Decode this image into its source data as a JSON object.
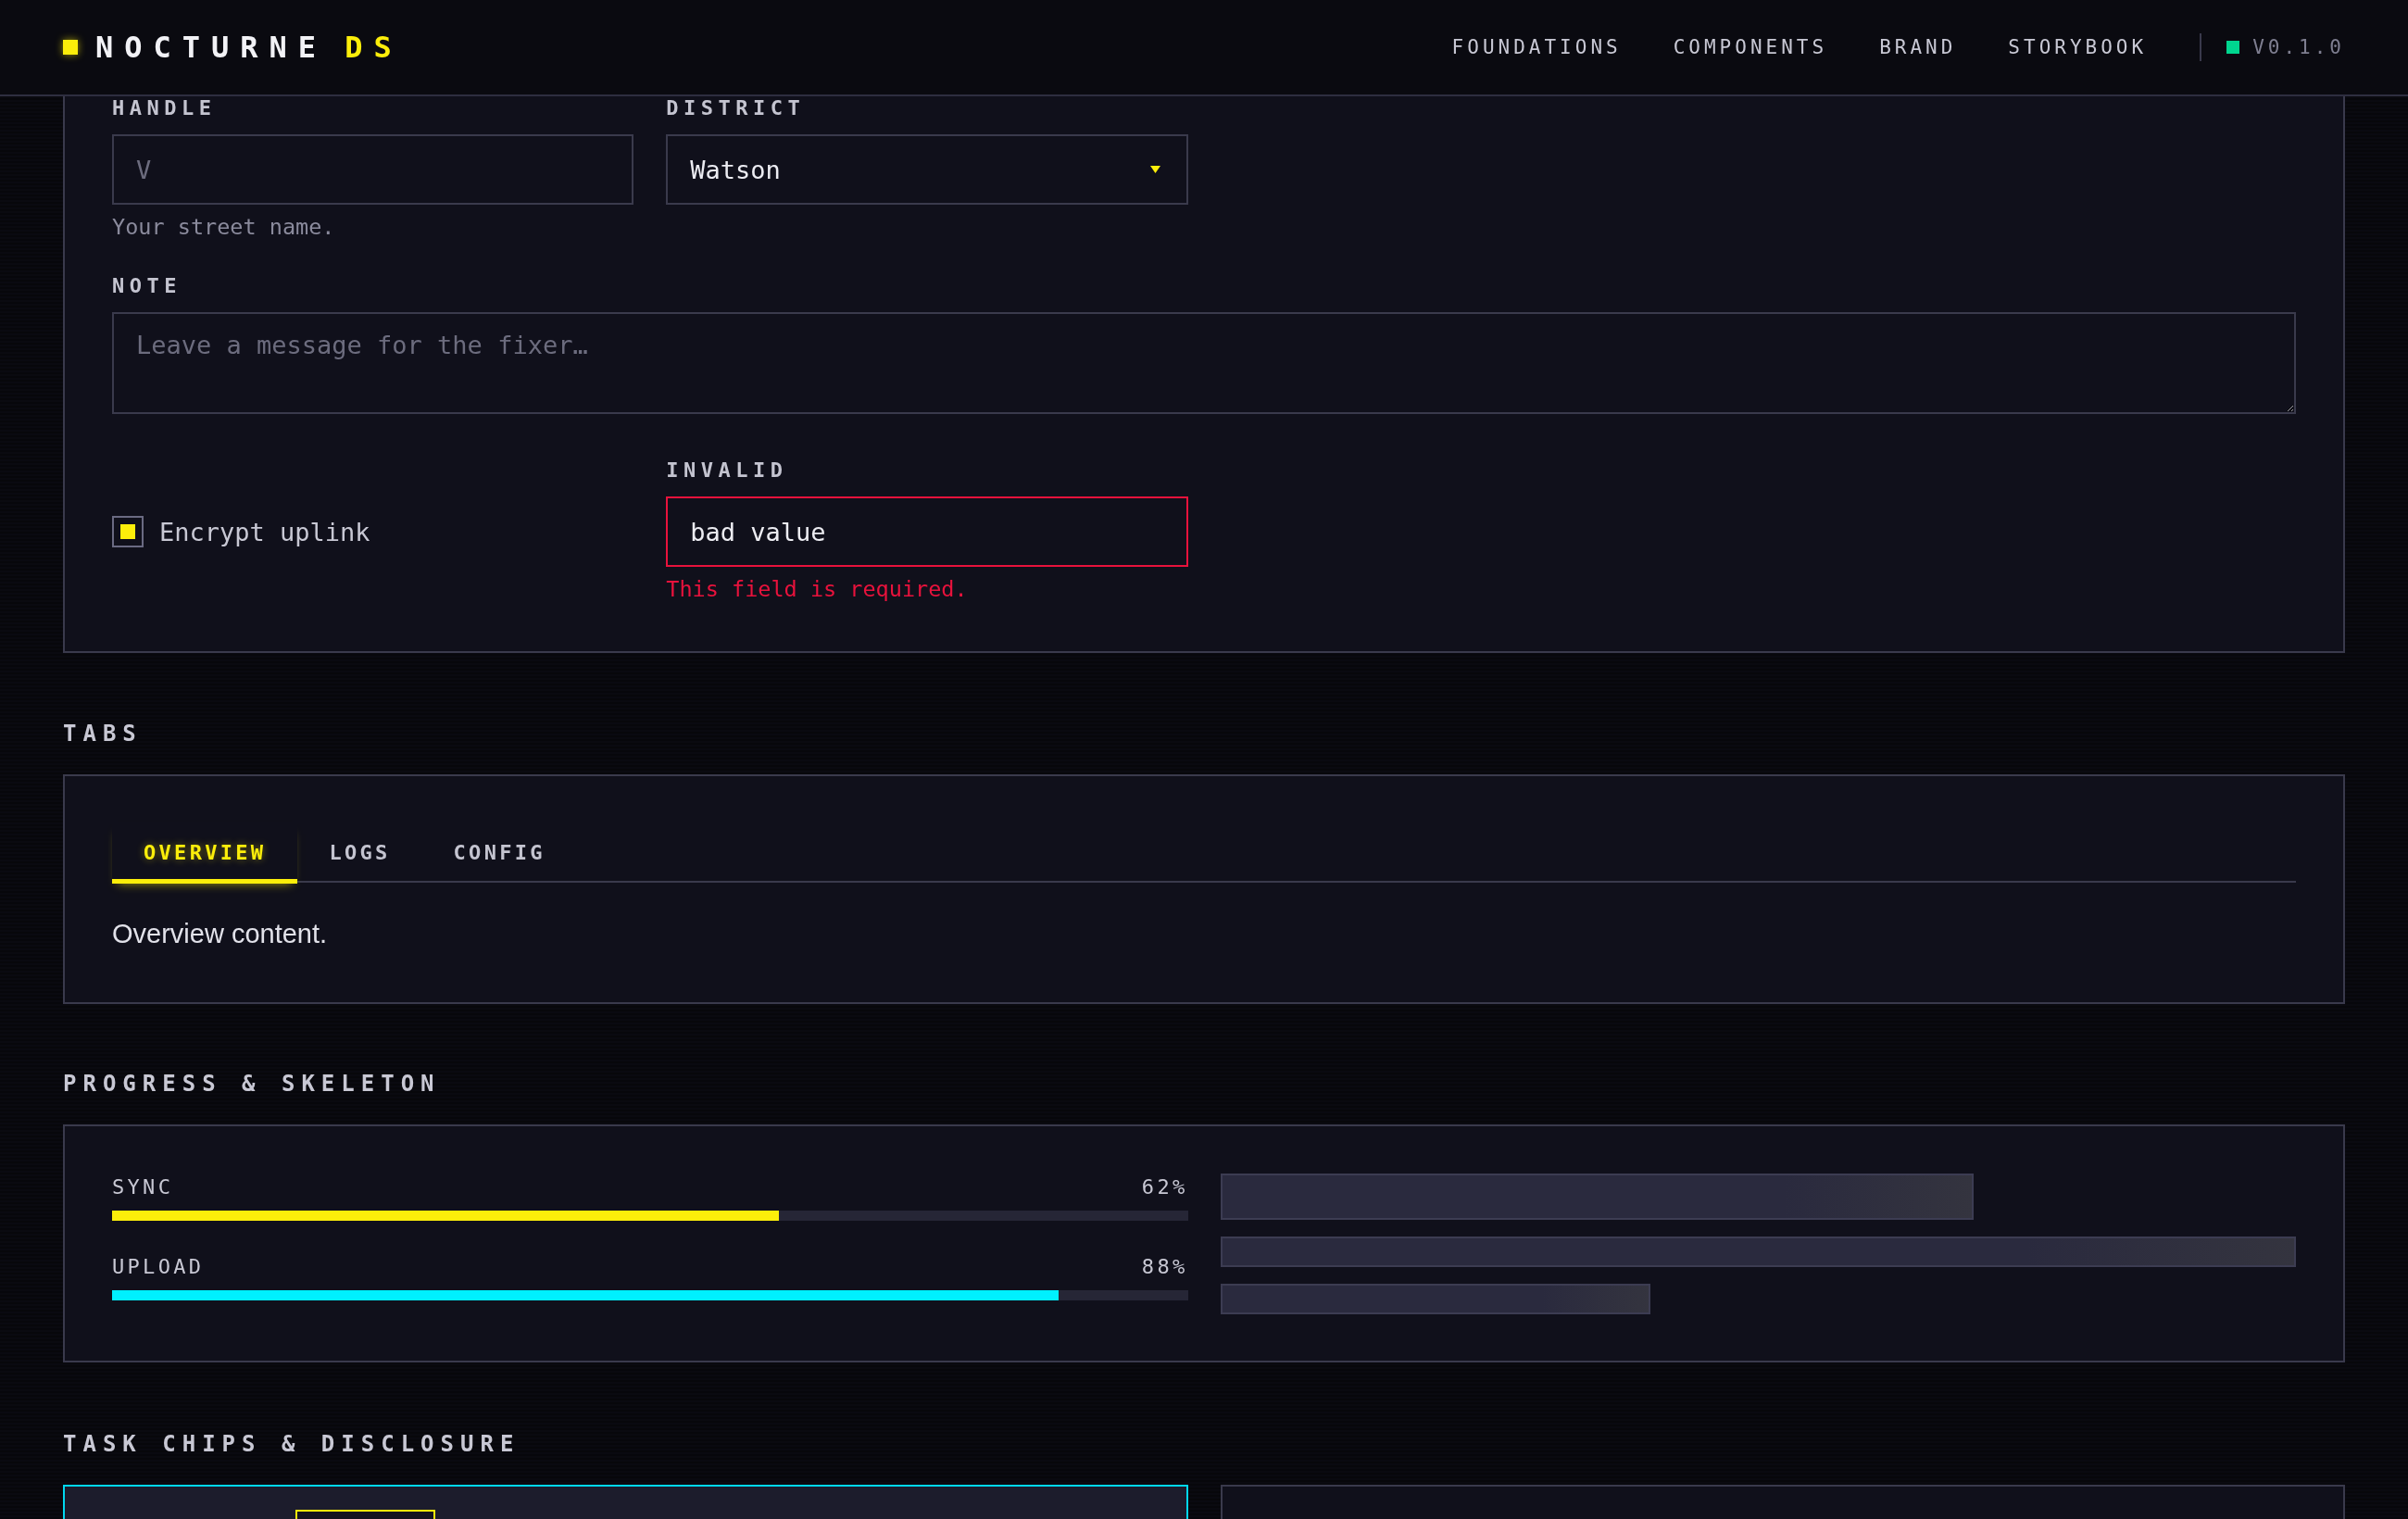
{
  "header": {
    "logo": {
      "name": "NOCTURNE",
      "suffix": "DS"
    },
    "nav": [
      {
        "label": "FOUNDATIONS"
      },
      {
        "label": "COMPONENTS"
      },
      {
        "label": "BRAND"
      },
      {
        "label": "STORYBOOK"
      }
    ],
    "version": "V0.1.0"
  },
  "form": {
    "handle": {
      "label": "HANDLE",
      "placeholder": "V",
      "helper": "Your street name."
    },
    "district": {
      "label": "DISTRICT",
      "value": "Watson"
    },
    "note": {
      "label": "NOTE",
      "placeholder": "Leave a message for the fixer…"
    },
    "encrypt": {
      "label": "Encrypt uplink",
      "checked": true
    },
    "invalid_field": {
      "label": "INVALID",
      "value": "bad value",
      "invalid": true,
      "error": "This field is required."
    }
  },
  "tabs_section": {
    "title": "TABS",
    "tabs": [
      {
        "label": "OVERVIEW",
        "selected": true
      },
      {
        "label": "LOGS",
        "selected": false
      },
      {
        "label": "CONFIG",
        "selected": false
      }
    ],
    "content": "Overview content."
  },
  "progress_section": {
    "title": "PROGRESS & SKELETON",
    "bars": [
      {
        "label": "SYNC",
        "reading": "62%",
        "level": 0.62,
        "color": "#fcee0a"
      },
      {
        "label": "UPLOAD",
        "reading": "88%",
        "level": 0.88,
        "color": "#00f0ff"
      }
    ]
  },
  "chips_section": {
    "title": "TASK CHIPS & DISCLOSURE"
  }
}
